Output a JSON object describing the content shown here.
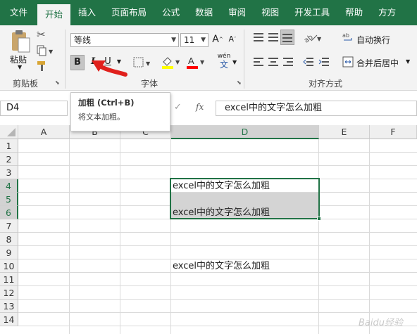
{
  "tabs": [
    "文件",
    "开始",
    "插入",
    "页面布局",
    "公式",
    "数据",
    "审阅",
    "视图",
    "开发工具",
    "帮助",
    "方方"
  ],
  "active_tab": "开始",
  "ribbon": {
    "clipboard": {
      "paste": "粘贴",
      "group_label": "剪贴板"
    },
    "font": {
      "font_name": "等线",
      "font_size": "11",
      "bold": "B",
      "italic": "I",
      "underline": "U",
      "group_label": "字体",
      "phonetic": "wén"
    },
    "alignment": {
      "wrap_text": "自动换行",
      "merge_center": "合并后居中",
      "group_label": "对齐方式"
    }
  },
  "tooltip": {
    "title": "加粗 (Ctrl+B)",
    "desc": "将文本加粗。"
  },
  "formula_bar": {
    "name_box": "D4",
    "fx": "fx",
    "value": "excel中的文字怎么加粗"
  },
  "columns": [
    "A",
    "B",
    "C",
    "D",
    "E",
    "F"
  ],
  "rows": [
    "1",
    "2",
    "3",
    "4",
    "5",
    "6",
    "7",
    "8",
    "9",
    "10",
    "11",
    "12",
    "13",
    "14"
  ],
  "cells": {
    "D4": "excel中的文字怎么加粗",
    "D6": "excel中的文字怎么加粗",
    "D10": "excel中的文字怎么加粗"
  },
  "watermark": "Baidu经验",
  "colors": {
    "ribbon_green": "#217346",
    "annotation_arrow": "#e0201c"
  }
}
